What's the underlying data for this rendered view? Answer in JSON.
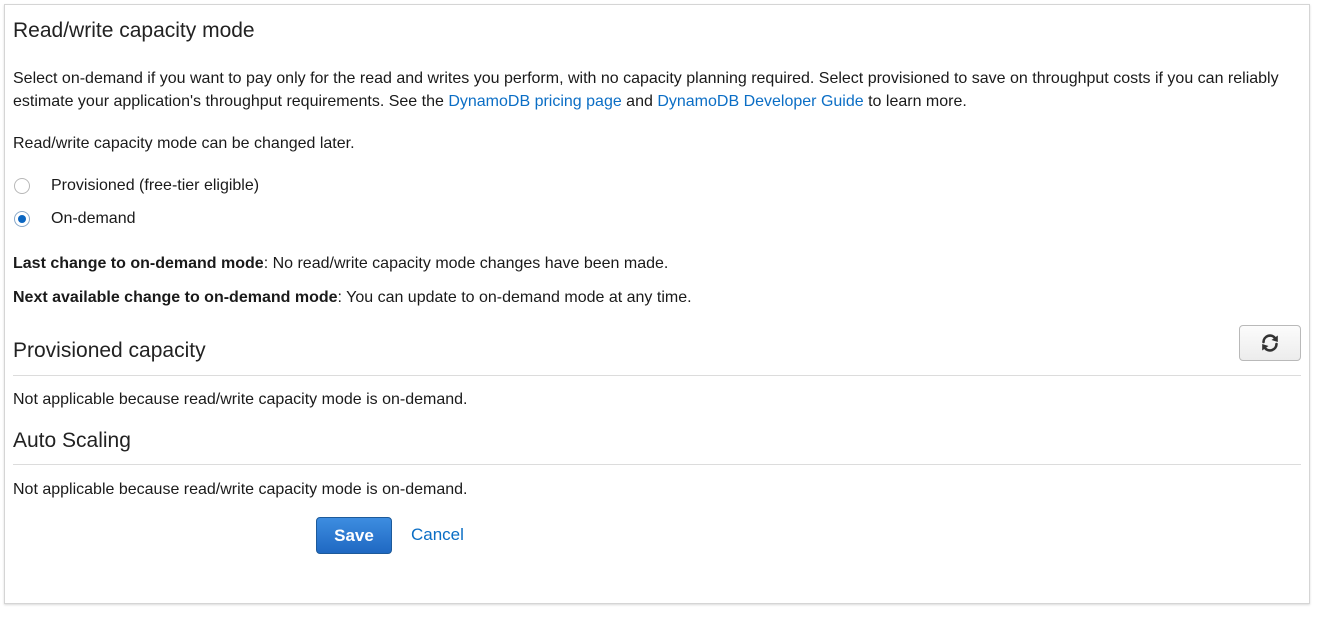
{
  "capacity_mode": {
    "title": "Read/write capacity mode",
    "description_part1": "Select on-demand if you want to pay only for the read and writes you perform, with no capacity planning required. Select provisioned to save on throughput costs if you can reliably estimate your application's throughput requirements. See the ",
    "pricing_link": "DynamoDB pricing page",
    "description_and": " and ",
    "guide_link": "DynamoDB Developer Guide",
    "description_part2": " to learn more.",
    "change_note": "Read/write capacity mode can be changed later.",
    "options": [
      {
        "label": "Provisioned (free-tier eligible)",
        "selected": false
      },
      {
        "label": "On-demand",
        "selected": true
      }
    ],
    "last_change_label": "Last change to on-demand mode",
    "last_change_value": ": No read/write capacity mode changes have been made.",
    "next_change_label": "Next available change to on-demand mode",
    "next_change_value": ": You can update to on-demand mode at any time."
  },
  "provisioned_capacity": {
    "title": "Provisioned capacity",
    "message": "Not applicable because read/write capacity mode is on-demand."
  },
  "auto_scaling": {
    "title": "Auto Scaling",
    "message": "Not applicable because read/write capacity mode is on-demand."
  },
  "actions": {
    "save_label": "Save",
    "cancel_label": "Cancel"
  },
  "icons": {
    "refresh": "refresh-icon"
  },
  "colors": {
    "link": "#0b6ec5",
    "primary_button": "#1f68c2",
    "radio_selected": "#0b66c2"
  }
}
